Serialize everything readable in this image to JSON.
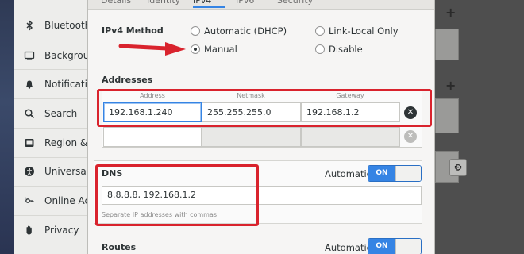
{
  "sidebar": {
    "items": [
      {
        "label": "Bluetooth",
        "icon": "bluetooth-icon"
      },
      {
        "label": "Background",
        "icon": "background-icon"
      },
      {
        "label": "Notifications",
        "icon": "bell-icon"
      },
      {
        "label": "Search",
        "icon": "search-icon"
      },
      {
        "label": "Region & Language",
        "icon": "region-icon"
      },
      {
        "label": "Universal Access",
        "icon": "accessibility-icon"
      },
      {
        "label": "Online Accounts",
        "icon": "online-accounts-icon"
      },
      {
        "label": "Privacy",
        "icon": "hand-icon"
      }
    ]
  },
  "dialog": {
    "tabs": [
      "Details",
      "Identity",
      "IPv4",
      "IPv6",
      "Security"
    ],
    "active_tab": 2,
    "ipv4": {
      "method_label": "IPv4 Method",
      "options": {
        "automatic": "Automatic (DHCP)",
        "link_local": "Link-Local Only",
        "manual": "Manual",
        "disable": "Disable"
      },
      "selected": "Manual"
    },
    "addresses": {
      "label": "Addresses",
      "headers": {
        "address": "Address",
        "netmask": "Netmask",
        "gateway": "Gateway"
      },
      "rows": [
        {
          "address": "192.168.1.240",
          "netmask": "255.255.255.0",
          "gateway": "192.168.1.2"
        },
        {
          "address": "",
          "netmask": "",
          "gateway": ""
        }
      ]
    },
    "dns": {
      "label": "DNS",
      "automatic_label": "Automatic",
      "switch_label": "ON",
      "value": "8.8.8.8, 192.168.1.2",
      "hint": "Separate IP addresses with commas"
    },
    "routes": {
      "label": "Routes",
      "automatic_label": "Automatic",
      "switch_label": "ON"
    }
  },
  "colors": {
    "accent": "#3584e4",
    "annotation": "#d9232d"
  }
}
